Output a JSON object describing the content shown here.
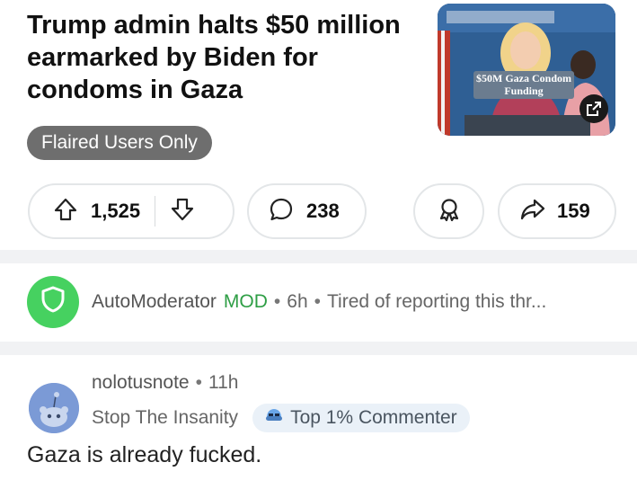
{
  "post": {
    "title": "Trump admin halts $50 million earmarked by Biden for condoms in Gaza",
    "flair": "Flaired Users Only",
    "thumbnail": {
      "caption": "$50M Gaza Condom Funding",
      "icon": "external-link-icon"
    }
  },
  "actions": {
    "upvotes": "1,525",
    "comments": "238",
    "shares": "159",
    "icons": [
      "upvote-icon",
      "downvote-icon",
      "comment-icon",
      "award-icon",
      "share-icon"
    ]
  },
  "automod": {
    "name": "AutoModerator",
    "mod_label": "MOD",
    "time": "6h",
    "preview": "Tired of reporting this thr..."
  },
  "comment": {
    "username": "nolotusnote",
    "time": "11h",
    "user_flair": "Stop The Insanity",
    "badge": "Top 1% Commenter",
    "body": "Gaza is already fucked."
  },
  "colors": {
    "mod_green": "#2e9e45",
    "shield_green": "#46d160",
    "flair_gray": "#6e6e6e",
    "badge_bg": "#eaf1f8"
  }
}
